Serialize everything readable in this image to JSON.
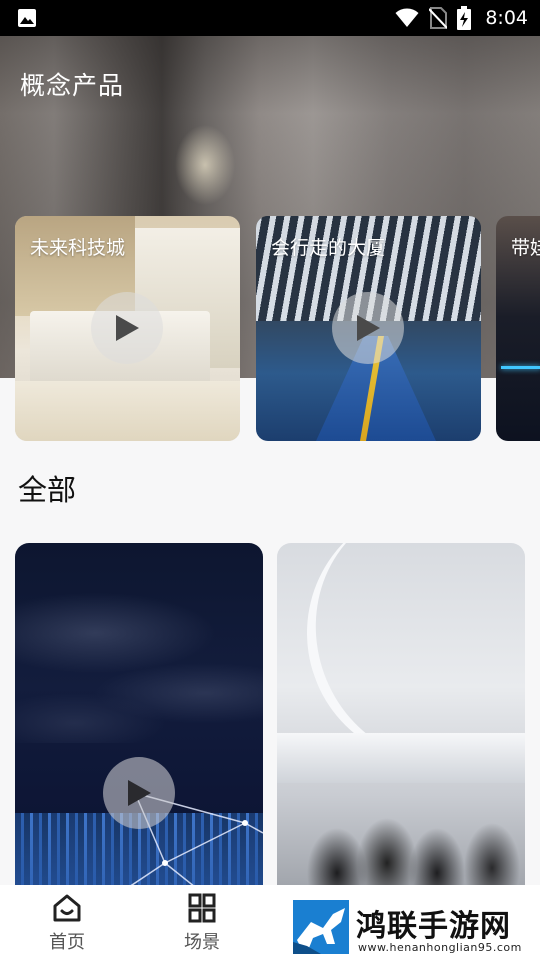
{
  "status_bar": {
    "time": "8:04",
    "icons": [
      "gallery-icon",
      "wifi-icon",
      "no-sim-icon",
      "battery-charging-icon"
    ]
  },
  "featured": {
    "title": "概念产品",
    "items": [
      {
        "label": "未来科技城",
        "has_play": true
      },
      {
        "label": "会行走的大厦",
        "has_play": true
      },
      {
        "label": "带娃",
        "has_play": false
      }
    ]
  },
  "all": {
    "title": "全部"
  },
  "bottom_nav": {
    "items": [
      {
        "label": "首页",
        "icon": "home-icon"
      },
      {
        "label": "场景",
        "icon": "grid-icon"
      }
    ]
  },
  "watermark": {
    "title": "鸿联手游网",
    "url": "www.henanhonglian95.com"
  }
}
